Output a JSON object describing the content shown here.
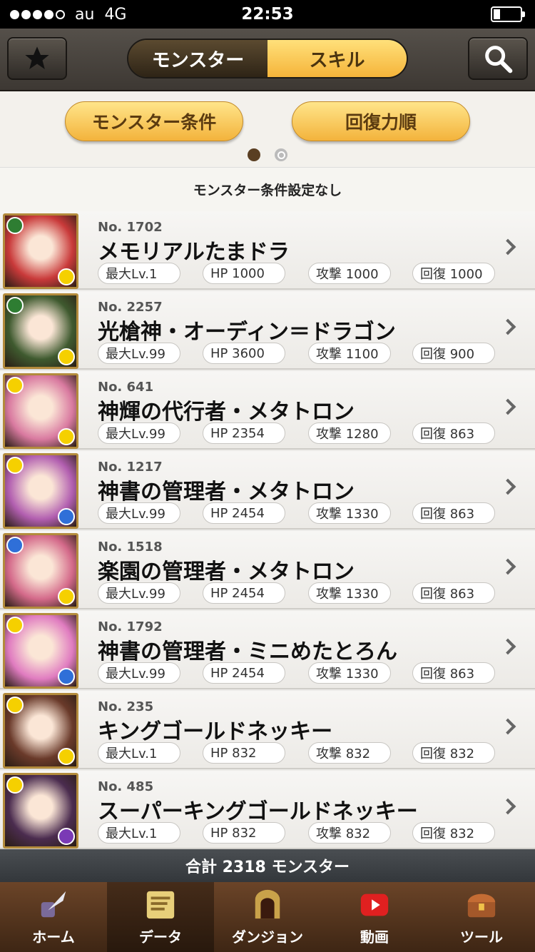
{
  "status": {
    "carrier": "au",
    "network": "4G",
    "time": "22:53"
  },
  "header": {
    "tabs": [
      "モンスター",
      "スキル"
    ],
    "active_tab": "モンスター"
  },
  "filters": {
    "buttons": [
      "モンスター条件",
      "回復力順"
    ]
  },
  "condition_text": "モンスター条件設定なし",
  "monsters": [
    {
      "no": "No. 1702",
      "name": "メモリアルたまドラ",
      "lv": "最大Lv.1",
      "hp": "HP 1000",
      "atk": "攻撃 1000",
      "rcv": "回復 1000",
      "colors": [
        "#2e7d32",
        "#f5d000"
      ]
    },
    {
      "no": "No. 2257",
      "name": "光槍神・オーディン＝ドラゴン",
      "lv": "最大Lv.99",
      "hp": "HP 3600",
      "atk": "攻撃 1100",
      "rcv": "回復 900",
      "colors": [
        "#2e7d32",
        "#f5d000"
      ]
    },
    {
      "no": "No. 641",
      "name": "神輝の代行者・メタトロン",
      "lv": "最大Lv.99",
      "hp": "HP 2354",
      "atk": "攻撃 1280",
      "rcv": "回復 863",
      "colors": [
        "#f5d000",
        "#f5d000"
      ]
    },
    {
      "no": "No. 1217",
      "name": "神書の管理者・メタトロン",
      "lv": "最大Lv.99",
      "hp": "HP 2454",
      "atk": "攻撃 1330",
      "rcv": "回復 863",
      "colors": [
        "#f5d000",
        "#2f6fd8"
      ]
    },
    {
      "no": "No. 1518",
      "name": "楽園の管理者・メタトロン",
      "lv": "最大Lv.99",
      "hp": "HP 2454",
      "atk": "攻撃 1330",
      "rcv": "回復 863",
      "colors": [
        "#2f6fd8",
        "#f5d000"
      ]
    },
    {
      "no": "No. 1792",
      "name": "神書の管理者・ミニめたとろん",
      "lv": "最大Lv.99",
      "hp": "HP 2454",
      "atk": "攻撃 1330",
      "rcv": "回復 863",
      "colors": [
        "#f5d000",
        "#2f6fd8"
      ]
    },
    {
      "no": "No. 235",
      "name": "キングゴールドネッキー",
      "lv": "最大Lv.1",
      "hp": "HP 832",
      "atk": "攻撃 832",
      "rcv": "回復 832",
      "colors": [
        "#f5d000",
        "#f5d000"
      ]
    },
    {
      "no": "No. 485",
      "name": "スーパーキングゴールドネッキー",
      "lv": "最大Lv.1",
      "hp": "HP 832",
      "atk": "攻撃 832",
      "rcv": "回復 832",
      "colors": [
        "#f5d000",
        "#7a3ab5"
      ]
    }
  ],
  "total_text": "合計 2318 モンスター",
  "tabbar": [
    {
      "label": "ホーム",
      "icon": "quill-icon"
    },
    {
      "label": "データ",
      "icon": "data-book-icon"
    },
    {
      "label": "ダンジョン",
      "icon": "dungeon-gate-icon"
    },
    {
      "label": "動画",
      "icon": "video-play-icon"
    },
    {
      "label": "ツール",
      "icon": "treasure-chest-icon"
    }
  ],
  "thumb_bg": [
    "#c93a3a",
    "#3f5a2f",
    "#d97aa0",
    "#b25fb0",
    "#d46a8a",
    "#e07cc0",
    "#6a3a2a",
    "#4b2c4f"
  ]
}
